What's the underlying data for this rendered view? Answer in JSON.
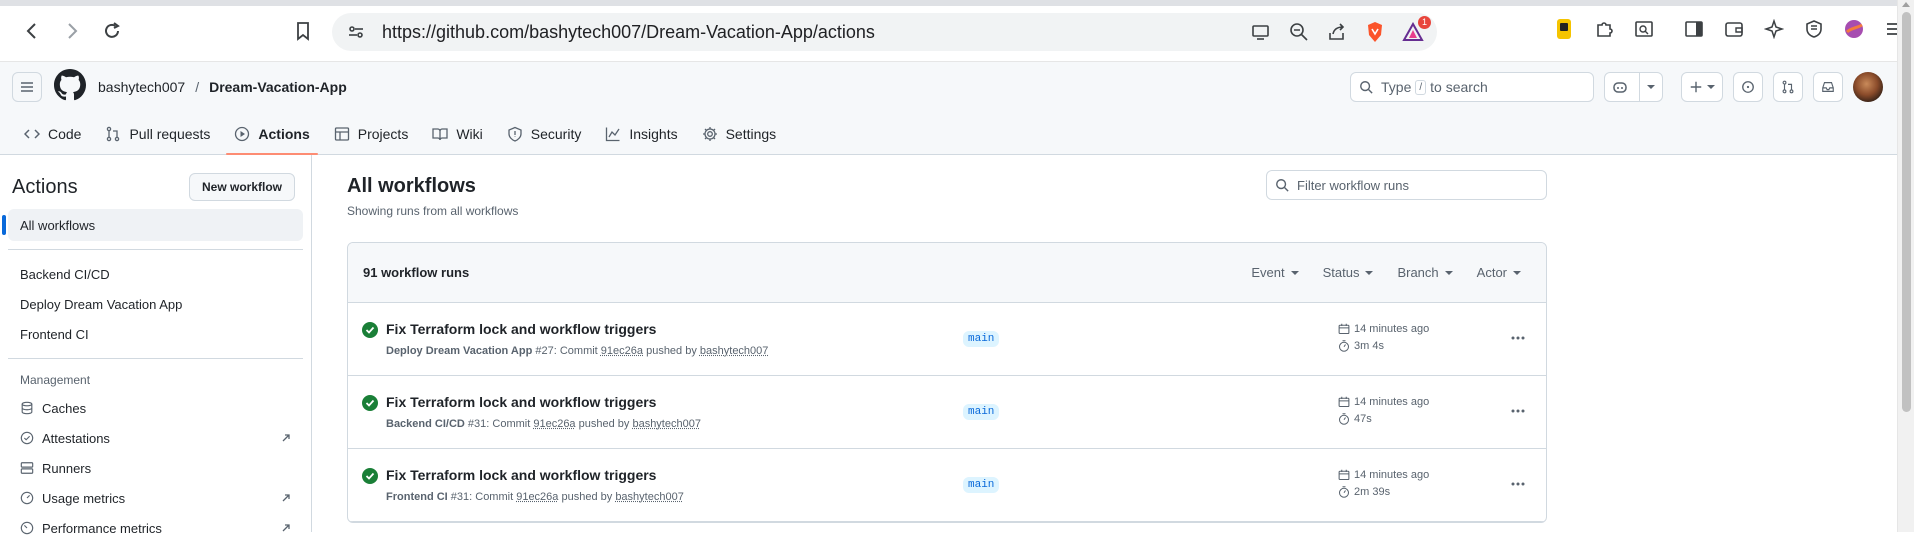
{
  "browser": {
    "url": "https://github.com/bashytech007/Dream-Vacation-App/actions",
    "notification_count": "1"
  },
  "header": {
    "owner": "bashytech007",
    "separator": "/",
    "repo": "Dream-Vacation-App",
    "search_placeholder_pre": "Type",
    "search_kbd": "/",
    "search_placeholder_post": "to search"
  },
  "tabs": [
    {
      "label": "Code"
    },
    {
      "label": "Pull requests"
    },
    {
      "label": "Actions"
    },
    {
      "label": "Projects"
    },
    {
      "label": "Wiki"
    },
    {
      "label": "Security"
    },
    {
      "label": "Insights"
    },
    {
      "label": "Settings"
    }
  ],
  "sidebar": {
    "title": "Actions",
    "new_workflow": "New workflow",
    "all_workflows": "All workflows",
    "workflows": [
      "Backend CI/CD",
      "Deploy Dream Vacation App",
      "Frontend CI"
    ],
    "management_label": "Management",
    "management": [
      {
        "label": "Caches"
      },
      {
        "label": "Attestations"
      },
      {
        "label": "Runners"
      },
      {
        "label": "Usage metrics"
      },
      {
        "label": "Performance metrics"
      }
    ]
  },
  "main": {
    "title": "All workflows",
    "subtitle": "Showing runs from all workflows",
    "filter_placeholder": "Filter workflow runs",
    "run_count": "91 workflow runs",
    "filters": [
      "Event",
      "Status",
      "Branch",
      "Actor"
    ],
    "runs": [
      {
        "title": "Fix Terraform lock and workflow triggers",
        "workflow": "Deploy Dream Vacation App",
        "number": "#27: Commit",
        "commit": "91ec26a",
        "pushed_by": "pushed by",
        "actor": "bashytech007",
        "branch": "main",
        "time": "14 minutes ago",
        "duration": "3m 4s"
      },
      {
        "title": "Fix Terraform lock and workflow triggers",
        "workflow": "Backend CI/CD",
        "number": "#31: Commit",
        "commit": "91ec26a",
        "pushed_by": "pushed by",
        "actor": "bashytech007",
        "branch": "main",
        "time": "14 minutes ago",
        "duration": "47s"
      },
      {
        "title": "Fix Terraform lock and workflow triggers",
        "workflow": "Frontend CI",
        "number": "#31: Commit",
        "commit": "91ec26a",
        "pushed_by": "pushed by",
        "actor": "bashytech007",
        "branch": "main",
        "time": "14 minutes ago",
        "duration": "2m 39s"
      }
    ]
  },
  "colors": {
    "accent": "#0969da",
    "tab_underline": "#fd8c73",
    "success": "#1a7f37",
    "branch_bg": "#ddf4ff"
  }
}
